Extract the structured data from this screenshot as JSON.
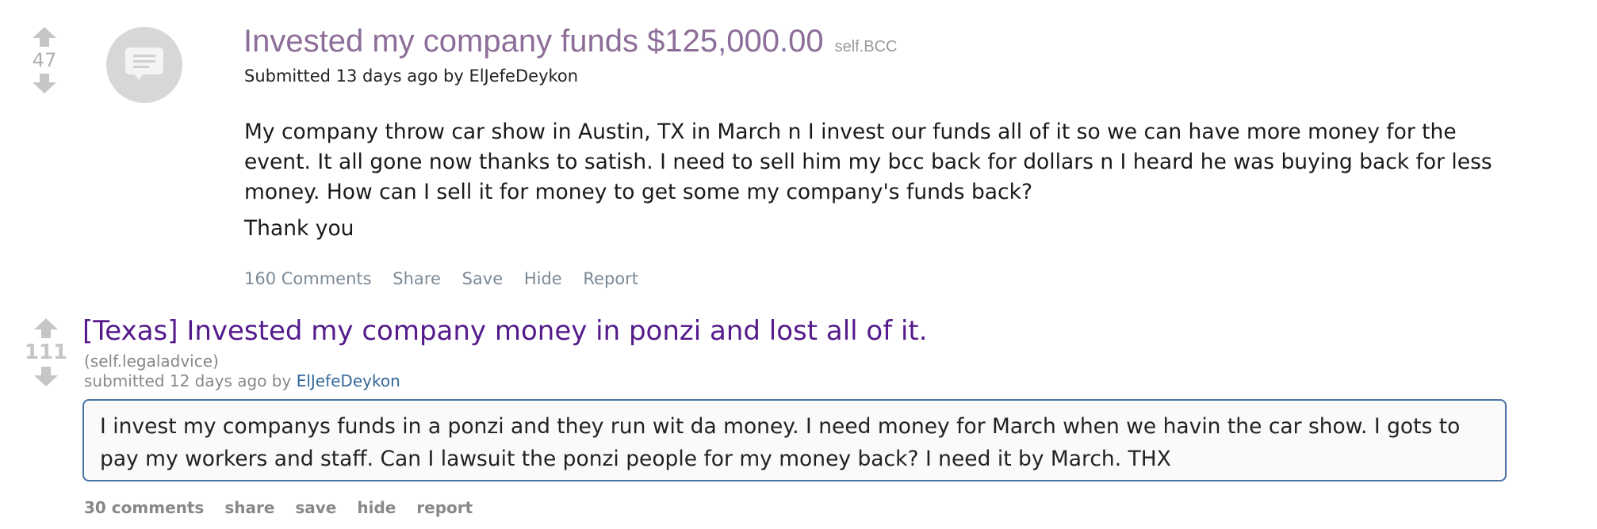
{
  "post1": {
    "score": "47",
    "title": "Invested my company funds $125,000.00",
    "domain": "self.BCC",
    "meta": "Submitted 13 days ago by ElJefeDeykon",
    "body": "My company throw car show in Austin, TX in March n I invest our funds all of it so we can have more money for the event. It all gone now thanks to satish. I need to sell him my bcc back for dollars n I heard he was buying back for less money. How can I sell it for money to get some my company's funds back?",
    "thanks": "Thank you",
    "actions": {
      "comments": "160 Comments",
      "share": "Share",
      "save": "Save",
      "hide": "Hide",
      "report": "Report"
    }
  },
  "post2": {
    "score": "111",
    "title": "[Texas] Invested my company money in ponzi and lost all of it.",
    "domain": "(self.legaladvice)",
    "meta_prefix": "submitted 12 days ago by",
    "author": "ElJefeDeykon",
    "body": "I invest my companys funds in a ponzi and they run wit da money. I need money for March when we havin the car show. I gots to pay my workers and staff. Can I lawsuit the ponzi people for my money back? I need it by March. THX",
    "actions": {
      "comments": "30 comments",
      "share": "share",
      "save": "save",
      "hide": "hide",
      "report": "report"
    }
  },
  "colors": {
    "visited_title": "#8c6e99",
    "old_title": "#551a8b",
    "author_link": "#336699",
    "vote_arrow": "#c6c6c6",
    "box_border": "#4a74a6"
  }
}
